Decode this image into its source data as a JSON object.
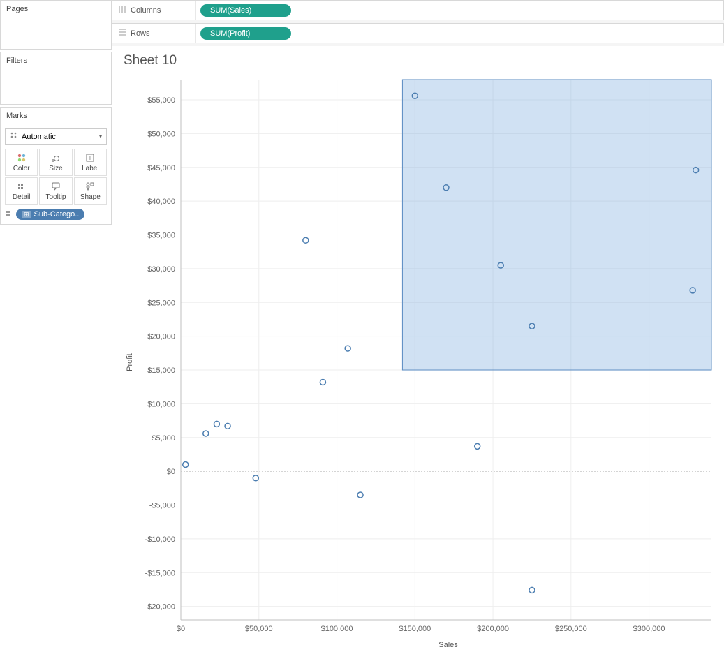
{
  "panels": {
    "pages": "Pages",
    "filters": "Filters",
    "marks": "Marks"
  },
  "marks": {
    "dropdown": "Automatic",
    "cells": {
      "color": "Color",
      "size": "Size",
      "label": "Label",
      "detail": "Detail",
      "tooltip": "Tooltip",
      "shape": "Shape"
    },
    "detailPill": "Sub-Catego.."
  },
  "shelves": {
    "columnsLabel": "Columns",
    "rowsLabel": "Rows",
    "columnsPill": "SUM(Sales)",
    "rowsPill": "SUM(Profit)"
  },
  "sheet": {
    "title": "Sheet 10",
    "xlabel": "Sales",
    "ylabel": "Profit"
  },
  "chart_data": {
    "type": "scatter",
    "xlabel": "Sales",
    "ylabel": "Profit",
    "xlim": [
      0,
      340000
    ],
    "ylim": [
      -22000,
      58000
    ],
    "y_ticks": [
      -20000,
      -15000,
      -10000,
      -5000,
      0,
      5000,
      10000,
      15000,
      20000,
      25000,
      30000,
      35000,
      40000,
      45000,
      50000,
      55000
    ],
    "y_tick_labels": [
      "-$20,000",
      "-$15,000",
      "-$10,000",
      "-$5,000",
      "$0",
      "$5,000",
      "$10,000",
      "$15,000",
      "$20,000",
      "$25,000",
      "$30,000",
      "$35,000",
      "$40,000",
      "$45,000",
      "$50,000",
      "$55,000"
    ],
    "x_ticks": [
      0,
      50000,
      100000,
      150000,
      200000,
      250000,
      300000
    ],
    "x_tick_labels": [
      "$0",
      "$50,000",
      "$100,000",
      "$150,000",
      "$200,000",
      "$250,000",
      "$300,000"
    ],
    "points": [
      {
        "x": 3000,
        "y": 1000
      },
      {
        "x": 16000,
        "y": 5600
      },
      {
        "x": 23000,
        "y": 7000
      },
      {
        "x": 30000,
        "y": 6700
      },
      {
        "x": 48000,
        "y": -1000
      },
      {
        "x": 80000,
        "y": 34200
      },
      {
        "x": 91000,
        "y": 13200
      },
      {
        "x": 107000,
        "y": 18200
      },
      {
        "x": 115000,
        "y": -3500
      },
      {
        "x": 150000,
        "y": 55600
      },
      {
        "x": 170000,
        "y": 42000
      },
      {
        "x": 190000,
        "y": 3700
      },
      {
        "x": 205000,
        "y": 30500
      },
      {
        "x": 225000,
        "y": -17600
      },
      {
        "x": 225000,
        "y": 21500
      },
      {
        "x": 328000,
        "y": 26800
      },
      {
        "x": 330000,
        "y": 44600
      }
    ],
    "selection": {
      "x1": 142000,
      "y1": 15000,
      "x2": 340000,
      "y2": 58000
    }
  }
}
